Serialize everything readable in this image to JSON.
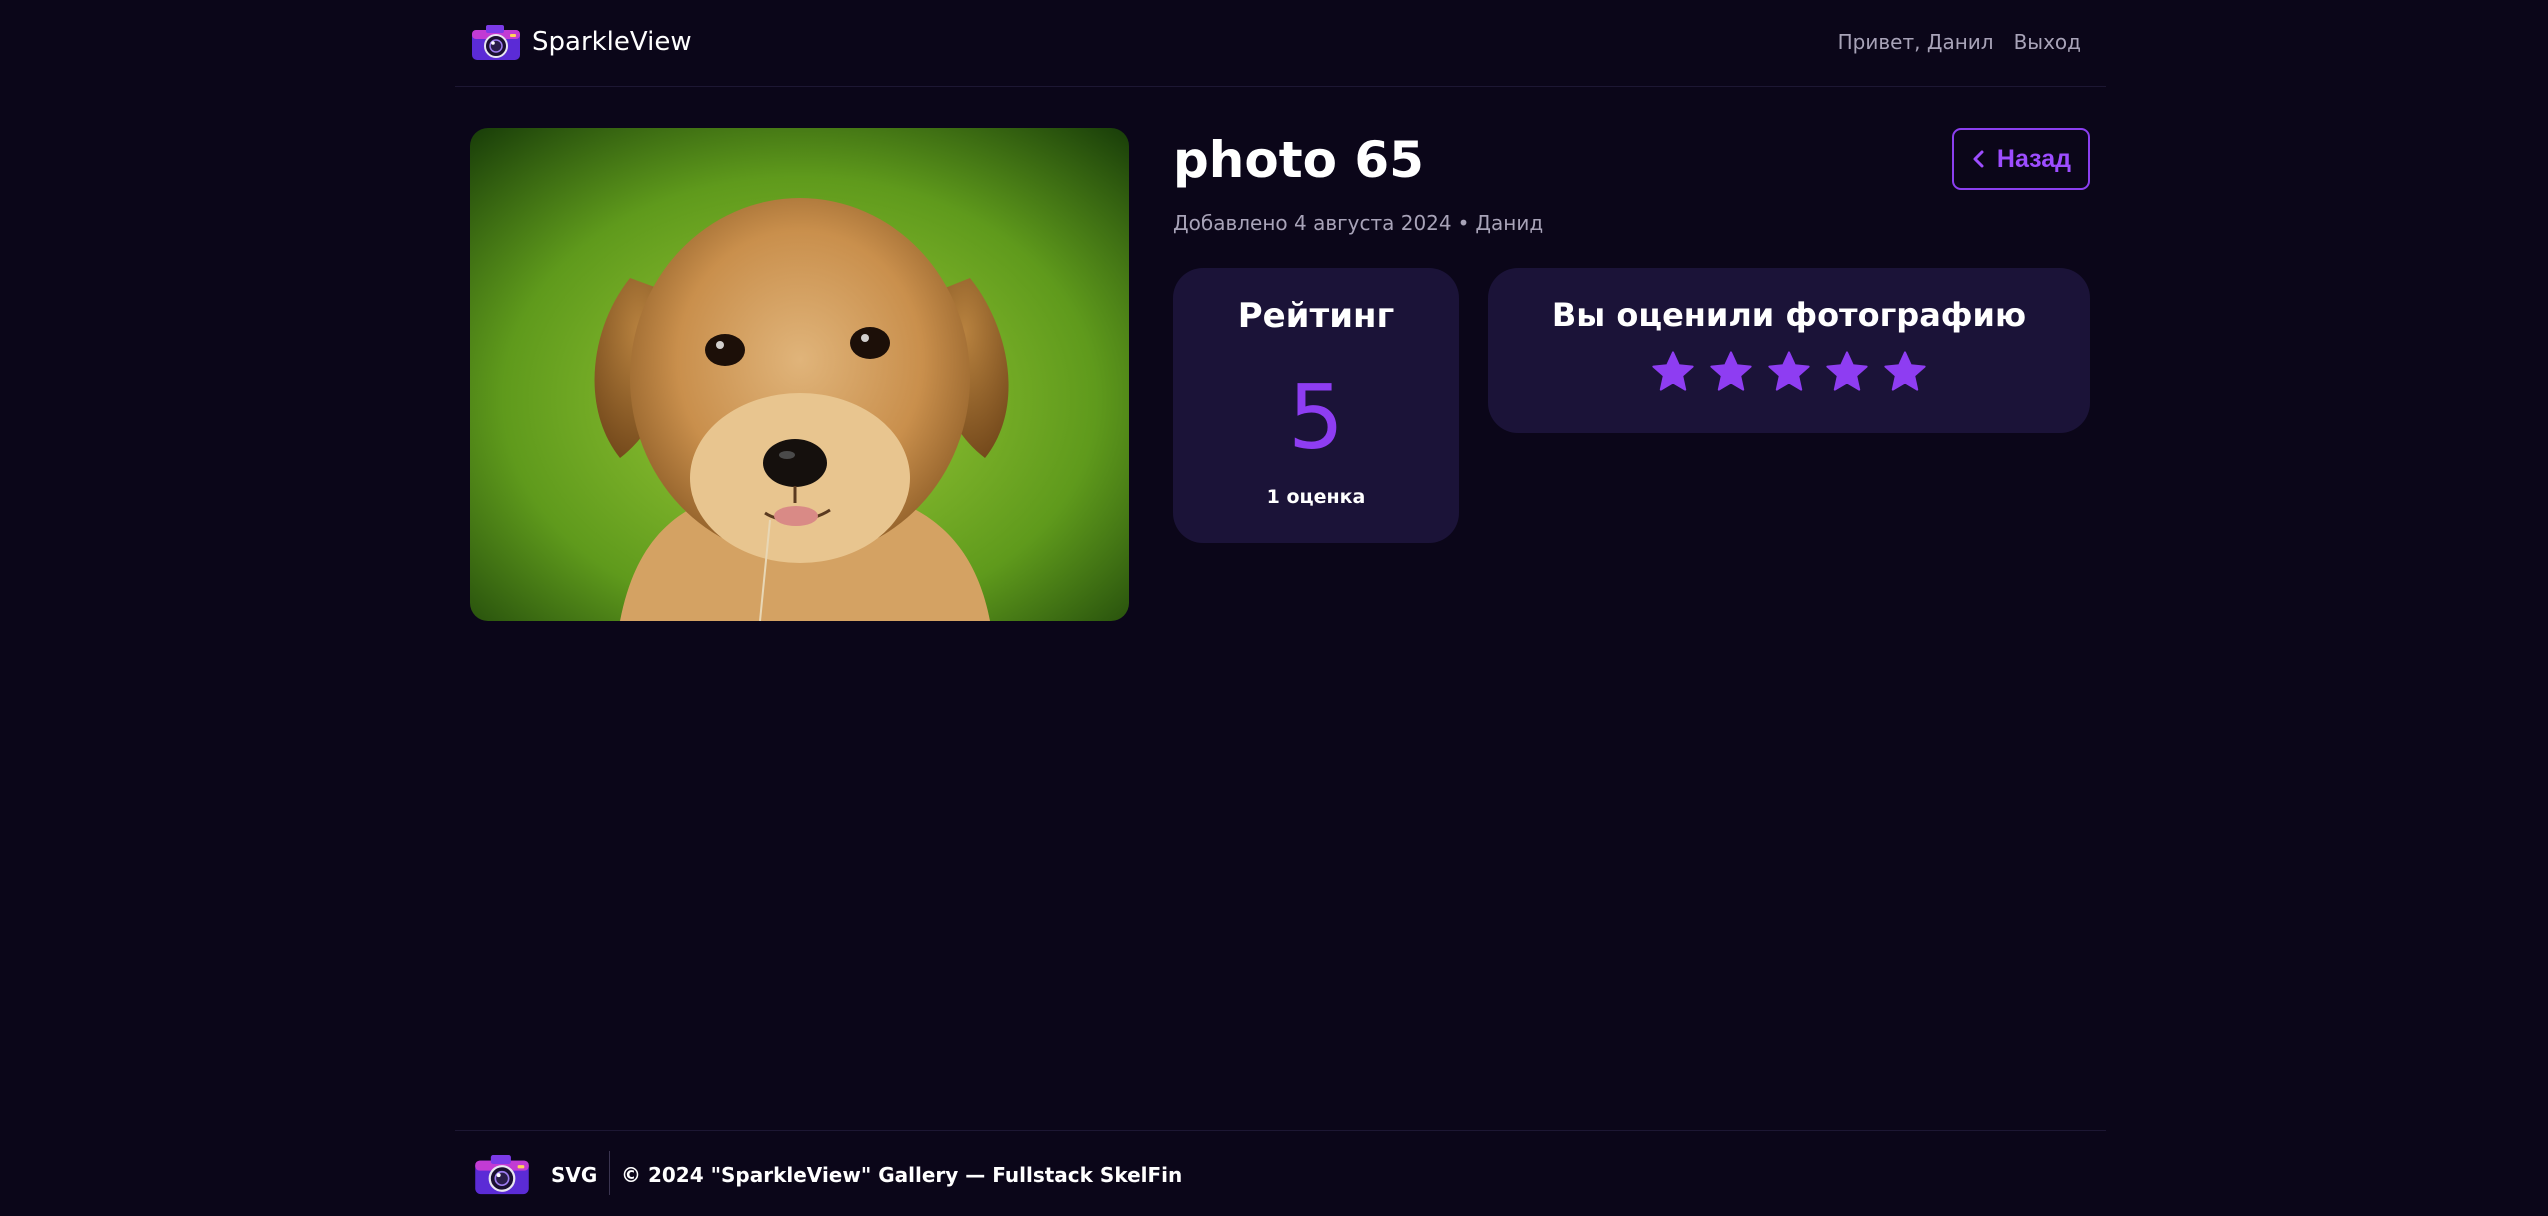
{
  "header": {
    "brand": "SparkleView",
    "greeting": "Привет, Данил",
    "logout": "Выход"
  },
  "photo": {
    "title": "photo 65",
    "meta_added": "Добавлено 4 августа 2024",
    "meta_separator": "•",
    "meta_author": "Данид"
  },
  "back_button": {
    "label": "Назад"
  },
  "rating": {
    "title": "Рейтинг",
    "value": "5",
    "count": "1 оценка"
  },
  "your_rating": {
    "title": "Вы оценили фотографию",
    "stars_filled": 5,
    "stars_total": 5
  },
  "footer": {
    "svg_label": "SVG",
    "copyright": "© 2024 \"SparkleView\" Gallery — Fullstack SkelFin"
  },
  "colors": {
    "background": "#0b0619",
    "card": "#1b1338",
    "accent": "#8e3df2",
    "muted_text": "#a8a3b8"
  }
}
